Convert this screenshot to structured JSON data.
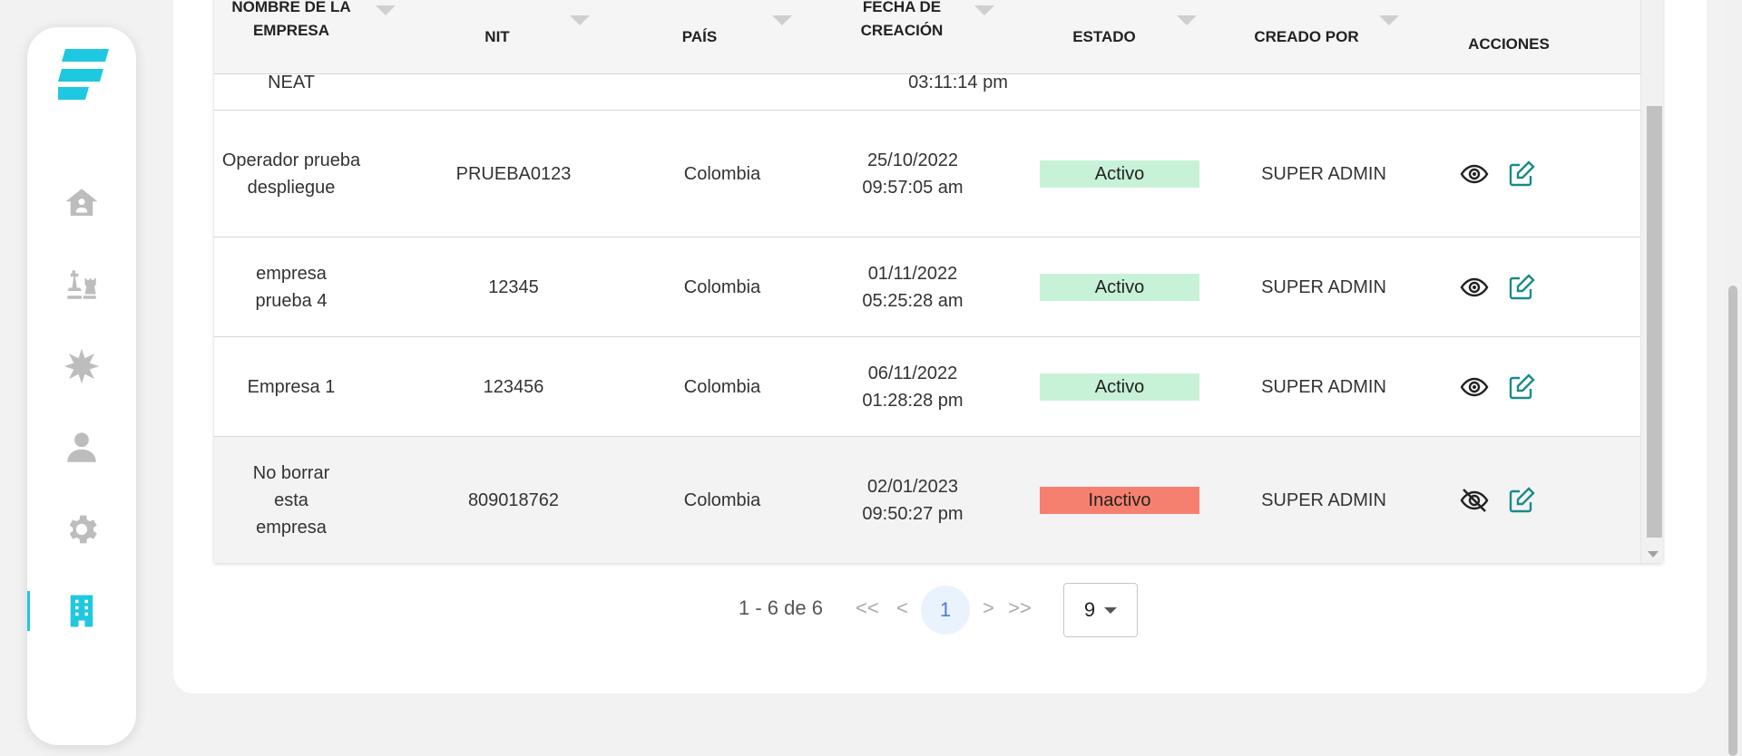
{
  "sidebar": {
    "items": [
      {
        "icon": "home-icon",
        "active": false
      },
      {
        "icon": "chess-icon",
        "active": false
      },
      {
        "icon": "burst-icon",
        "active": false
      },
      {
        "icon": "user-icon",
        "active": false
      },
      {
        "icon": "gear-icon",
        "active": false
      },
      {
        "icon": "building-icon",
        "active": true
      }
    ],
    "accent_color": "#1ec8e0"
  },
  "table": {
    "headers": {
      "empresa": "NOMBRE DE LA EMPRESA",
      "nit": "NIT",
      "pais": "PAÍS",
      "fecha": "FECHA DE CREACIÓN",
      "estado": "ESTADO",
      "creado_por": "CREADO POR",
      "acciones": "ACCIONES"
    },
    "partial_row": {
      "empresa": "NEAT",
      "fecha": "03:11:14 pm"
    },
    "rows": [
      {
        "empresa": "Operador prueba despliegue",
        "nit": "PRUEBA0123",
        "pais": "Colombia",
        "fecha": "25/10/2022",
        "hora": "09:57:05 am",
        "estado": "Activo",
        "creado_por": "SUPER ADMIN"
      },
      {
        "empresa": "empresa prueba 4",
        "nit": "12345",
        "pais": "Colombia",
        "fecha": "01/11/2022",
        "hora": "05:25:28 am",
        "estado": "Activo",
        "creado_por": "SUPER ADMIN"
      },
      {
        "empresa": "Empresa 1",
        "nit": "123456",
        "pais": "Colombia",
        "fecha": "06/11/2022",
        "hora": "01:28:28 pm",
        "estado": "Activo",
        "creado_por": "SUPER ADMIN"
      },
      {
        "empresa": "No borrar esta empresa",
        "nit": "809018762",
        "pais": "Colombia",
        "fecha": "02/01/2023",
        "hora": "09:50:27 pm",
        "estado": "Inactivo",
        "creado_por": "SUPER ADMIN"
      }
    ],
    "status_colors": {
      "Activo": "#c8f2d8",
      "Inactivo": "#f6806f"
    }
  },
  "pagination": {
    "range": "1 - 6 de 6",
    "first": "<<",
    "prev": "<",
    "current_page": "1",
    "next": ">",
    "last": ">>",
    "per_page": "9"
  }
}
